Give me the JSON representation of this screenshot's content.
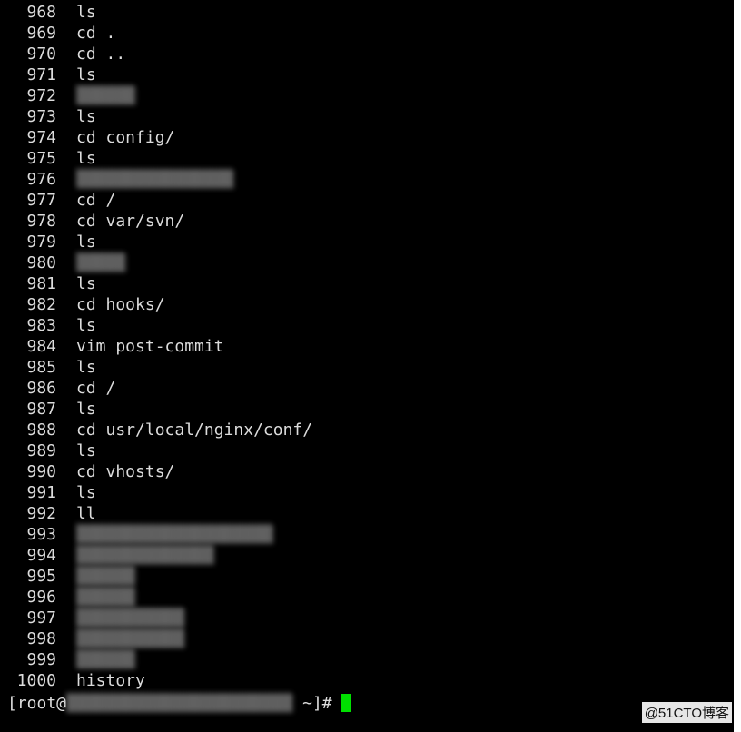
{
  "terminal": {
    "history": [
      {
        "num": "968",
        "cmd": "ls"
      },
      {
        "num": "969",
        "cmd": "cd ."
      },
      {
        "num": "970",
        "cmd": "cd .."
      },
      {
        "num": "971",
        "cmd": "ls"
      },
      {
        "num": "972",
        "cmd": "",
        "redacted": true
      },
      {
        "num": "973",
        "cmd": "ls"
      },
      {
        "num": "974",
        "cmd": "cd config/"
      },
      {
        "num": "975",
        "cmd": "ls"
      },
      {
        "num": "976",
        "cmd": "",
        "redacted": true
      },
      {
        "num": "977",
        "cmd": "cd /"
      },
      {
        "num": "978",
        "cmd": "cd var/svn/"
      },
      {
        "num": "979",
        "cmd": "ls"
      },
      {
        "num": "980",
        "cmd": "",
        "redacted": true
      },
      {
        "num": "981",
        "cmd": "ls"
      },
      {
        "num": "982",
        "cmd": "cd hooks/"
      },
      {
        "num": "983",
        "cmd": "ls"
      },
      {
        "num": "984",
        "cmd": "vim post-commit"
      },
      {
        "num": "985",
        "cmd": "ls"
      },
      {
        "num": "986",
        "cmd": "cd /"
      },
      {
        "num": "987",
        "cmd": "ls"
      },
      {
        "num": "988",
        "cmd": "cd usr/local/nginx/conf/"
      },
      {
        "num": "989",
        "cmd": "ls"
      },
      {
        "num": "990",
        "cmd": "cd vhosts/"
      },
      {
        "num": "991",
        "cmd": "ls"
      },
      {
        "num": "992",
        "cmd": "ll"
      },
      {
        "num": "993",
        "cmd": "",
        "redacted": true
      },
      {
        "num": "994",
        "cmd": "",
        "redacted": true
      },
      {
        "num": "995",
        "cmd": "",
        "redacted": true
      },
      {
        "num": "996",
        "cmd": "",
        "redacted": true
      },
      {
        "num": "997",
        "cmd": "",
        "redacted": true
      },
      {
        "num": "998",
        "cmd": "",
        "redacted": true
      },
      {
        "num": "999",
        "cmd": "",
        "redacted": true
      },
      {
        "num": "1000",
        "cmd": "history"
      }
    ],
    "prompt_prefix": "[root@",
    "prompt_suffix": " ~]#"
  },
  "watermark": "@51CTO博客",
  "colors": {
    "background": "#000000",
    "text": "#dcdcdc",
    "cursor": "#00e000"
  }
}
